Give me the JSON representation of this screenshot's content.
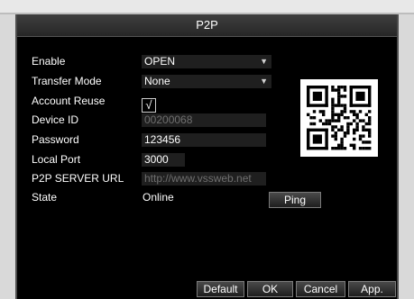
{
  "title": "P2P",
  "fields": {
    "enable": {
      "label": "Enable",
      "value": "OPEN"
    },
    "transfer_mode": {
      "label": "Transfer Mode",
      "value": "None"
    },
    "account_reuse": {
      "label": "Account Reuse",
      "checked": true,
      "check_glyph": "√"
    },
    "device_id": {
      "label": "Device ID",
      "value": "00200068"
    },
    "password": {
      "label": "Password",
      "value": "123456"
    },
    "local_port": {
      "label": "Local Port",
      "value": "3000"
    },
    "p2p_server_url": {
      "label": "P2P SERVER URL",
      "value": "http://www.vssweb.net"
    },
    "state": {
      "label": "State",
      "value": "Online"
    }
  },
  "buttons": {
    "ping": "Ping",
    "default": "Default",
    "ok": "OK",
    "cancel": "Cancel",
    "apply": "App."
  },
  "icons": {
    "dropdown_arrow": "▼"
  },
  "colors": {
    "window_bg": "#000000",
    "field_bg": "#1f1f1f",
    "text": "#ffffff",
    "dim_text": "#6f6f6f"
  }
}
